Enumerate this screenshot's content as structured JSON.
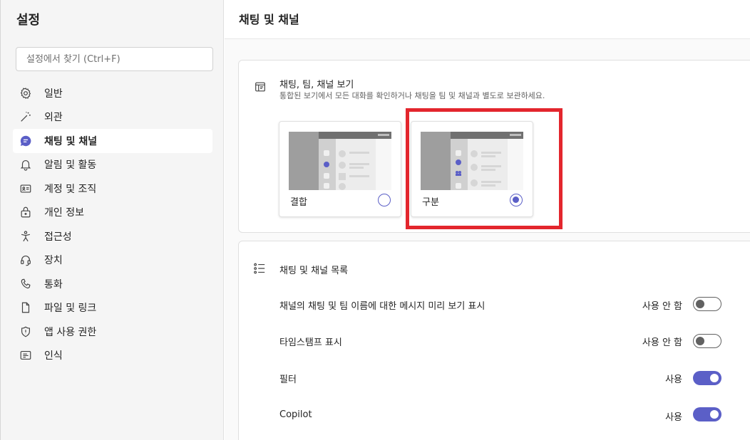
{
  "sidebar": {
    "title": "설정",
    "search_placeholder": "설정에서 찾기 (Ctrl+F)",
    "items": [
      {
        "label": "일반",
        "icon": "gear-icon"
      },
      {
        "label": "외관",
        "icon": "magic-wand-icon"
      },
      {
        "label": "채팅 및 채널",
        "icon": "chat-icon",
        "active": true
      },
      {
        "label": "알림 및 활동",
        "icon": "bell-icon"
      },
      {
        "label": "계정 및 조직",
        "icon": "id-card-icon"
      },
      {
        "label": "개인 정보",
        "icon": "lock-icon"
      },
      {
        "label": "접근성",
        "icon": "accessibility-icon"
      },
      {
        "label": "장치",
        "icon": "headset-icon"
      },
      {
        "label": "통화",
        "icon": "phone-icon"
      },
      {
        "label": "파일 및 링크",
        "icon": "document-icon"
      },
      {
        "label": "앱 사용 권한",
        "icon": "shield-icon"
      },
      {
        "label": "인식",
        "icon": "recognition-icon"
      }
    ]
  },
  "main": {
    "title": "채팅 및 채널",
    "view_section": {
      "title": "채팅, 팀, 채널 보기",
      "description": "통합된 보기에서 모든 대화를 확인하거나 채팅을 팀 및 채널과 별도로 보관하세요.",
      "options": [
        {
          "label": "결합",
          "selected": false
        },
        {
          "label": "구분",
          "selected": true
        }
      ]
    },
    "list_section": {
      "title": "채팅 및 채널 목록",
      "rows": [
        {
          "label": "채널의 채팅 및 팀 이름에 대한 메시지 미리 보기 표시",
          "status": "사용 안 함",
          "on": false
        },
        {
          "label": "타임스탬프 표시",
          "status": "사용 안 함",
          "on": false
        },
        {
          "label": "필터",
          "status": "사용",
          "on": true
        },
        {
          "label": "Copilot",
          "status": "사용",
          "on": true
        }
      ]
    }
  },
  "colors": {
    "accent": "#5b5fc7",
    "highlight": "#e3262d"
  }
}
